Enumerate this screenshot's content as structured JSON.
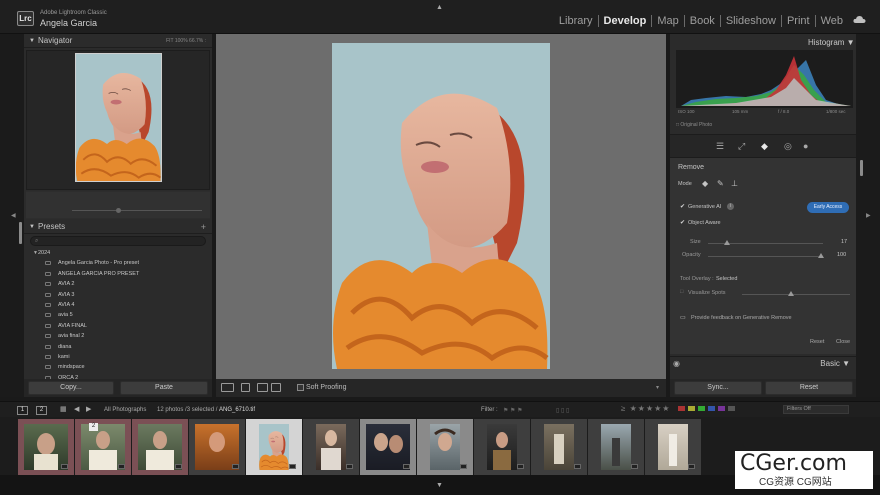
{
  "app": {
    "logo": "Lrc",
    "name": "Adobe Lightroom Classic",
    "user": "Angela Garcia"
  },
  "modules": [
    {
      "label": "Library"
    },
    {
      "label": "Develop",
      "active": true
    },
    {
      "label": "Map"
    },
    {
      "label": "Book"
    },
    {
      "label": "Slideshow"
    },
    {
      "label": "Print"
    },
    {
      "label": "Web"
    }
  ],
  "navigator": {
    "title": "Navigator",
    "zoom": "FIT    100%    66.7%  :"
  },
  "presets": {
    "title": "Presets",
    "add": "+",
    "group": "2024",
    "items": [
      "Angela Garcia Photo - Pro preset",
      "ANGELA GARCIA PRO PRESET",
      "AVIA 2",
      "AVIA 3",
      "AVIA 4",
      "avia 5",
      "AVIA FINAL",
      "avia final 2",
      "diana",
      "kami",
      "mindspace",
      "ORCA 2"
    ]
  },
  "left_buttons": {
    "copy": "Copy...",
    "paste": "Paste"
  },
  "toolbar": {
    "soft_proofing": "Soft Proofing"
  },
  "histogram": {
    "title": "Histogram",
    "iso": "ISO 100",
    "focal": "105 mm",
    "aperture": "f / 8.0",
    "shutter": "1/800 sec",
    "original_photo": "Original Photo"
  },
  "remove": {
    "title": "Remove",
    "mode_label": "Mode",
    "generative_ai": "Generative AI",
    "early_access": "Early Access",
    "object_aware": "Object Aware",
    "size_label": "Size",
    "size_value": "17",
    "opacity_label": "Opacity",
    "opacity_value": "100",
    "tool_overlay_label": "Tool Overlay :",
    "tool_overlay_value": "Selected",
    "visualize_spots": "Visualize Spots",
    "feedback": "Provide feedback on Generative Remove",
    "reset": "Reset",
    "close": "Close"
  },
  "basic": {
    "title": "Basic"
  },
  "right_buttons": {
    "sync": "Sync...",
    "reset": "Reset"
  },
  "filmstrip_bar": {
    "page1": "1",
    "page2": "2",
    "source": "All Photographs",
    "count": "12 photos /3 selected /",
    "filename": "ANG_6710.tif",
    "filter_label": "Filter :",
    "filter_value": "Filters Off",
    "rating": "≥ ★★★★★"
  },
  "filmstrip": {
    "marker_2": "2"
  },
  "watermark": {
    "main": "CGer.com",
    "sub": "CG资源 CG网站"
  },
  "colors": {
    "accent": "#2f6db5",
    "selected_cell": "#7b5055",
    "panel": "#2b2b2b"
  }
}
